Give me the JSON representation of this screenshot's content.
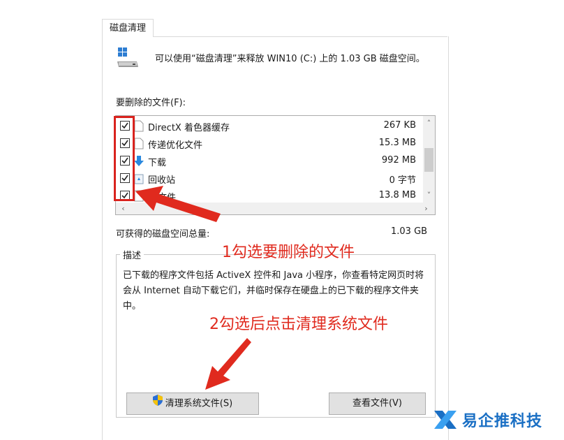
{
  "window": {
    "tab_label": "磁盘清理",
    "intro_text": "可以使用“磁盘清理”来释放 WIN10 (C:) 上的 1.03 GB 磁盘空间。",
    "files_label": "要删除的文件(F):",
    "files": [
      {
        "name": "DirectX 着色器缓存",
        "size": "267 KB",
        "checked": true,
        "icon": "blank-file-icon"
      },
      {
        "name": "传递优化文件",
        "size": "15.3 MB",
        "checked": true,
        "icon": "blank-file-icon"
      },
      {
        "name": "下载",
        "size": "992 MB",
        "checked": true,
        "icon": "download-arrow-icon"
      },
      {
        "name": "回收站",
        "size": "0 字节",
        "checked": true,
        "icon": "recycle-bin-icon"
      },
      {
        "name": "文件",
        "size": "13.8 MB",
        "checked": true,
        "icon": "blank-file-icon"
      }
    ],
    "total_label": "可获得的磁盘空间总量:",
    "total_value": "1.03 GB",
    "description_legend": "描述",
    "description_text": "已下载的程序文件包括 ActiveX 控件和 Java 小程序，你查看特定网页时将会从 Internet 自动下载它们，并临时保存在硬盘上的已下载的程序文件夹中。",
    "clean_system_button": "清理系统文件(S)",
    "view_files_button": "查看文件(V)"
  },
  "annotations": {
    "step1": "1勾选要删除的文件",
    "step2": "2勾选后点击清理系统文件"
  },
  "watermark": {
    "text": "易企推科技"
  },
  "colors": {
    "annotation_red": "#e02a1e",
    "logo_blue": "#1a6fc4",
    "button_bg": "#e1e1e1"
  }
}
